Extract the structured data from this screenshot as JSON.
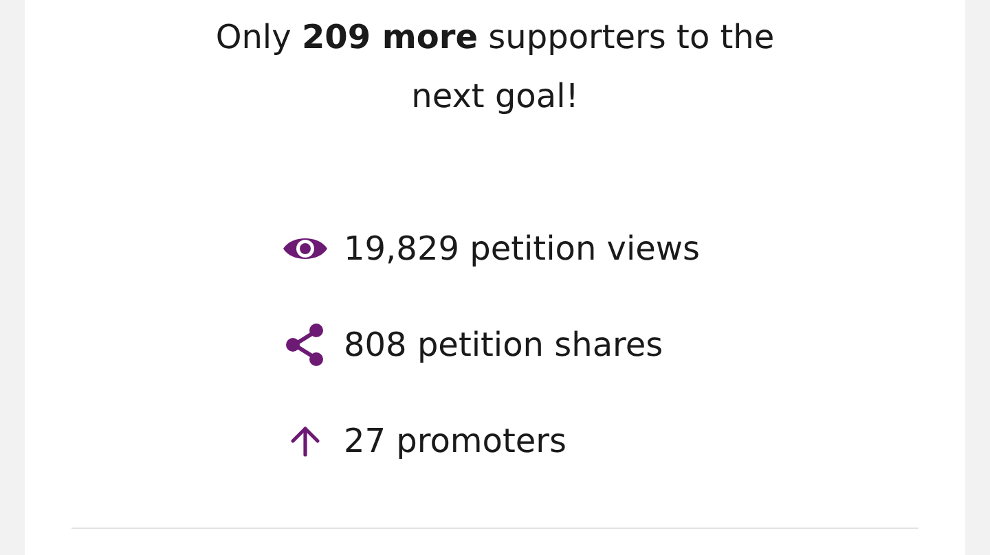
{
  "goal_message": "Only **209 more** supporters to the next goal!",
  "stats": [
    {
      "kind": "views",
      "text": "19,829 petition views"
    },
    {
      "kind": "shares",
      "text": "808 petition shares"
    },
    {
      "kind": "promoters",
      "text": "27 promoters"
    }
  ]
}
